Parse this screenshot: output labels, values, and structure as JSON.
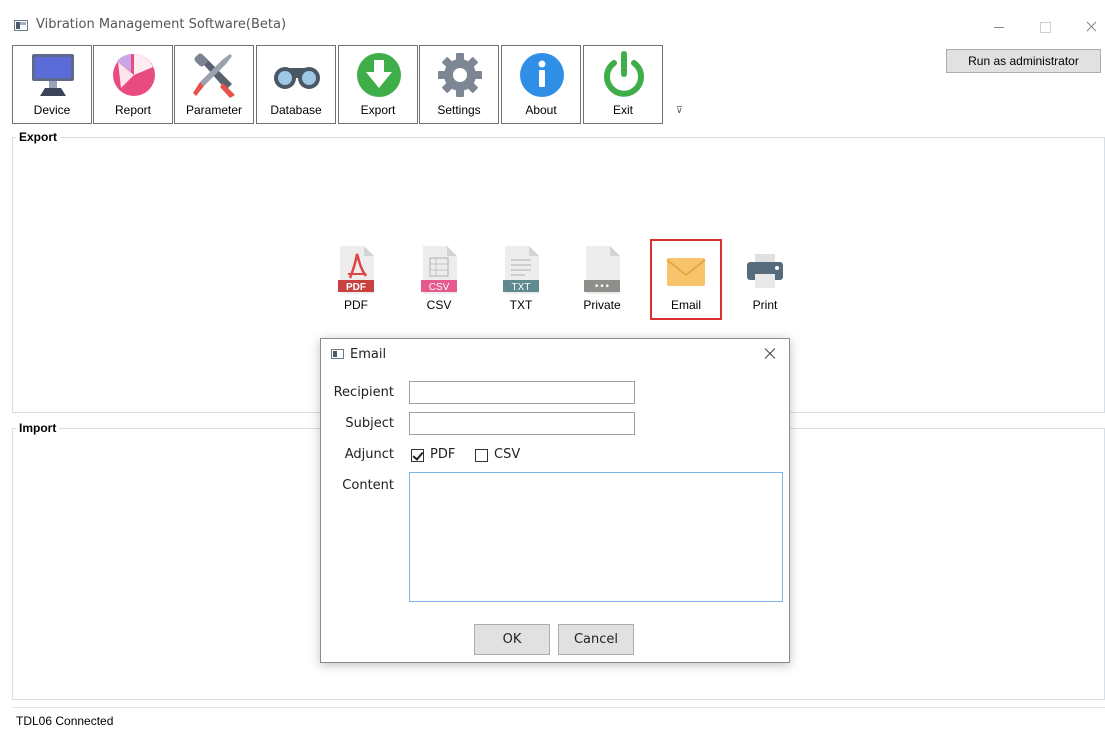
{
  "window": {
    "title": "Vibration Management Software(Beta)",
    "admin_button": "Run as administrator"
  },
  "toolbar": {
    "items": [
      {
        "label": "Device",
        "icon": "monitor-icon"
      },
      {
        "label": "Report",
        "icon": "pie-chart-icon"
      },
      {
        "label": "Parameter",
        "icon": "tools-icon"
      },
      {
        "label": "Database",
        "icon": "binoculars-icon"
      },
      {
        "label": "Export",
        "icon": "download-icon"
      },
      {
        "label": "Settings",
        "icon": "gear-icon"
      },
      {
        "label": "About",
        "icon": "info-icon"
      },
      {
        "label": "Exit",
        "icon": "power-icon"
      }
    ],
    "overflow": "⊽"
  },
  "export": {
    "title": "Export",
    "items": [
      {
        "label": "PDF",
        "icon": "pdf-file-icon",
        "tag": "PDF"
      },
      {
        "label": "CSV",
        "icon": "csv-file-icon",
        "tag": "CSV"
      },
      {
        "label": "TXT",
        "icon": "txt-file-icon",
        "tag": "TXT"
      },
      {
        "label": "Private",
        "icon": "private-file-icon",
        "tag": "•••"
      },
      {
        "label": "Email",
        "icon": "envelope-icon",
        "selected": true
      },
      {
        "label": "Print",
        "icon": "printer-icon"
      }
    ]
  },
  "import": {
    "title": "Import"
  },
  "dialog": {
    "title": "Email",
    "recipient_label": "Recipient",
    "recipient_value": "",
    "subject_label": "Subject",
    "subject_value": "",
    "adjunct_label": "Adjunct",
    "pdf_label": "PDF",
    "pdf_checked": true,
    "csv_label": "CSV",
    "csv_checked": false,
    "content_label": "Content",
    "content_value": "",
    "ok_label": "OK",
    "cancel_label": "Cancel"
  },
  "status": {
    "text": "TDL06 Connected"
  },
  "colors": {
    "highlight": "#d9302f",
    "focus_border": "#7eb4ea"
  }
}
